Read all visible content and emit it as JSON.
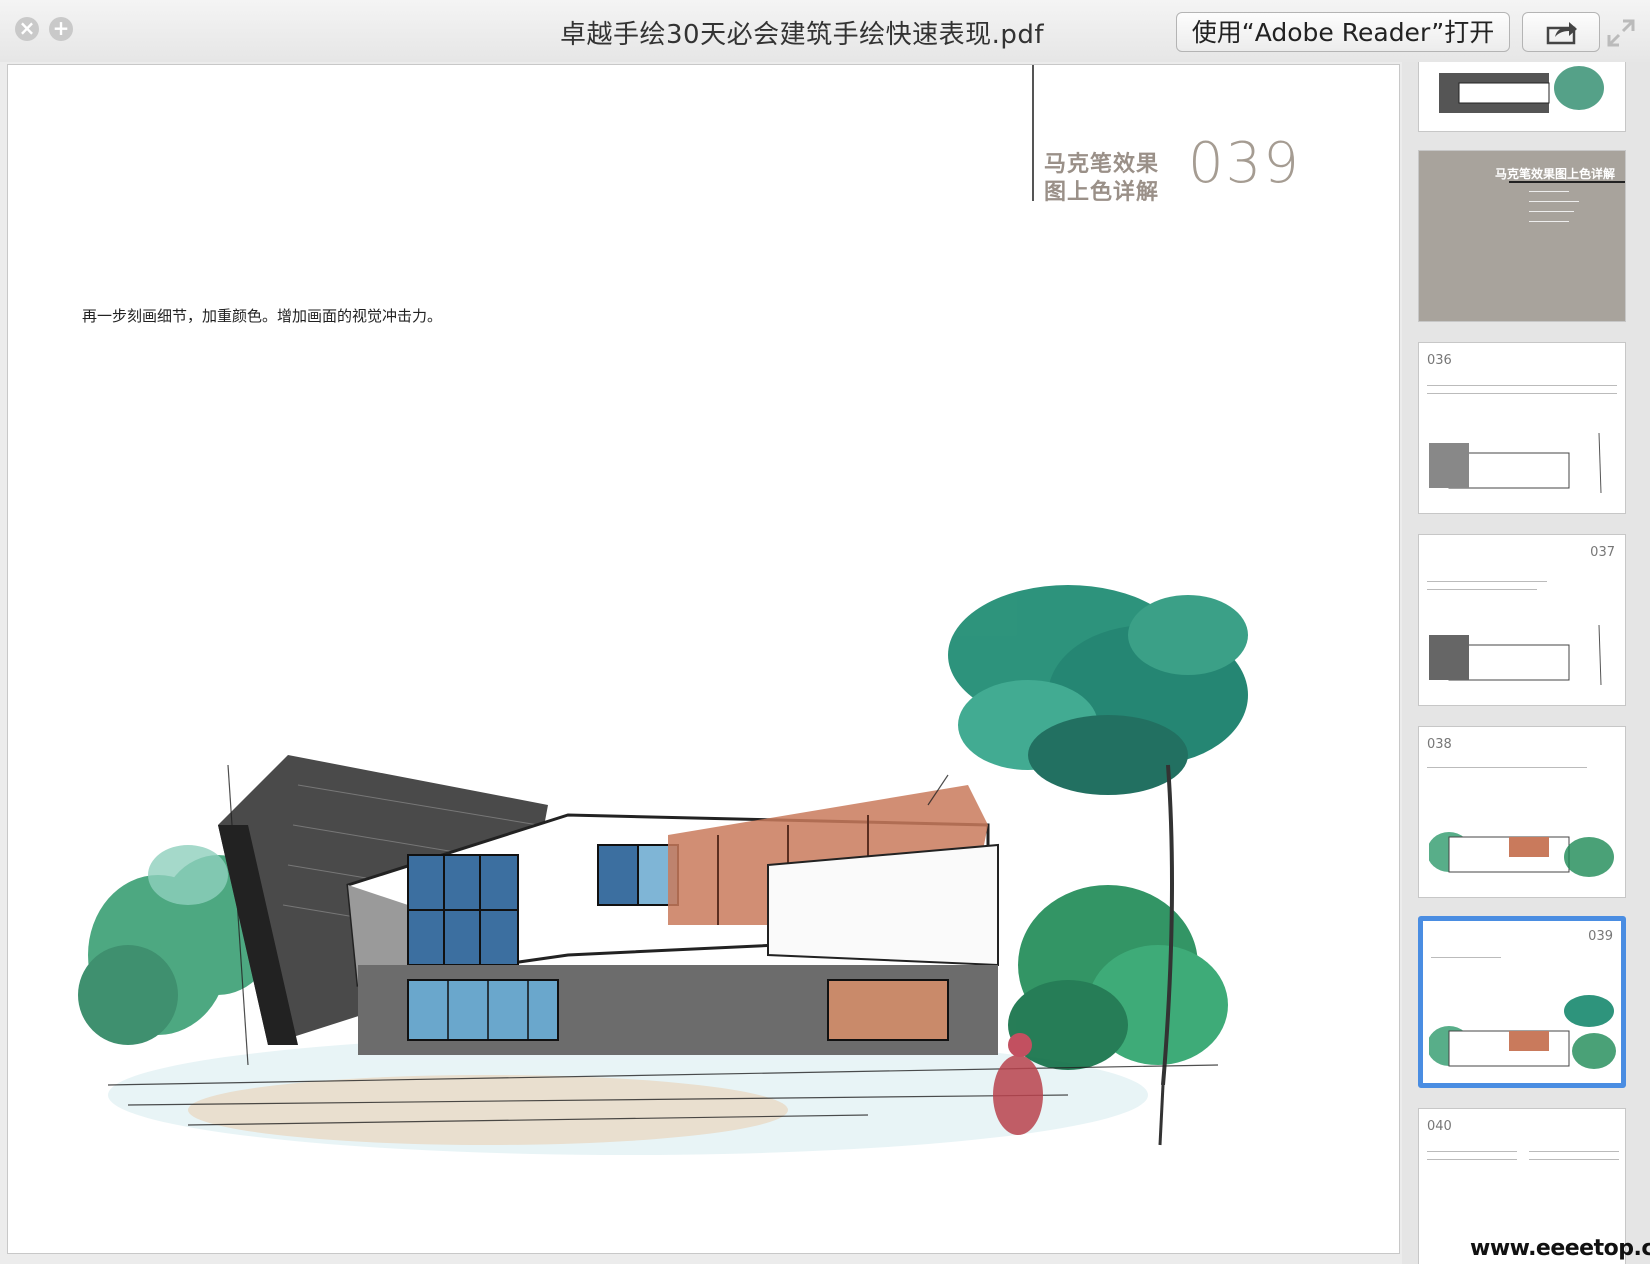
{
  "window": {
    "title": "卓越手绘30天必会建筑手绘快速表现.pdf",
    "open_button_label": "使用“Adobe Reader”打开"
  },
  "page": {
    "chapter_title_line1": "马克笔效果",
    "chapter_title_line2": "图上色详解",
    "page_number": "039",
    "caption": "再一步刻画细节，加重颜色。增加画面的视觉冲击力。"
  },
  "thumbnails": [
    {
      "label": "",
      "kind": "sketch-color"
    },
    {
      "label": "马克笔效果图上色详解",
      "kind": "chapter-cover"
    },
    {
      "label": "036",
      "kind": "sketch-bw"
    },
    {
      "label": "037",
      "kind": "sketch-bw"
    },
    {
      "label": "038",
      "kind": "sketch-color"
    },
    {
      "label": "039",
      "kind": "sketch-color",
      "selected": true
    },
    {
      "label": "040",
      "kind": "text"
    }
  ],
  "watermark": "www.eeeetop.com",
  "colors": {
    "selection": "#4a8de2",
    "tree_green": "#1f8a6e",
    "brick": "#b86a4e"
  }
}
